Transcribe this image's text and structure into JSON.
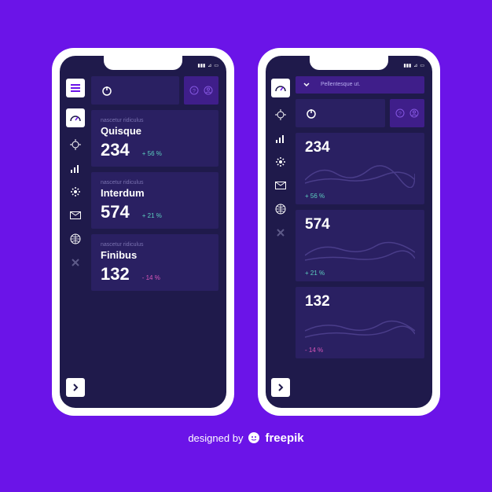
{
  "attribution": {
    "text": "designed by",
    "brand": "freepik"
  },
  "dropdown": {
    "label": "Pellentesque ut."
  },
  "cards_left": [
    {
      "sub": "nascetur ridiculus",
      "title": "Quisque",
      "value": "234",
      "change": "+ 56 %",
      "dir": "up"
    },
    {
      "sub": "nascetur ridiculus",
      "title": "Interdum",
      "value": "574",
      "change": "+ 21 %",
      "dir": "up"
    },
    {
      "sub": "nascetur ridiculus",
      "title": "Finibus",
      "value": "132",
      "change": "- 14 %",
      "dir": "down"
    }
  ],
  "cards_right": [
    {
      "value": "234",
      "change": "+ 56 %",
      "dir": "up"
    },
    {
      "value": "574",
      "change": "+ 21 %",
      "dir": "up"
    },
    {
      "value": "132",
      "change": "- 14 %",
      "dir": "down"
    }
  ]
}
